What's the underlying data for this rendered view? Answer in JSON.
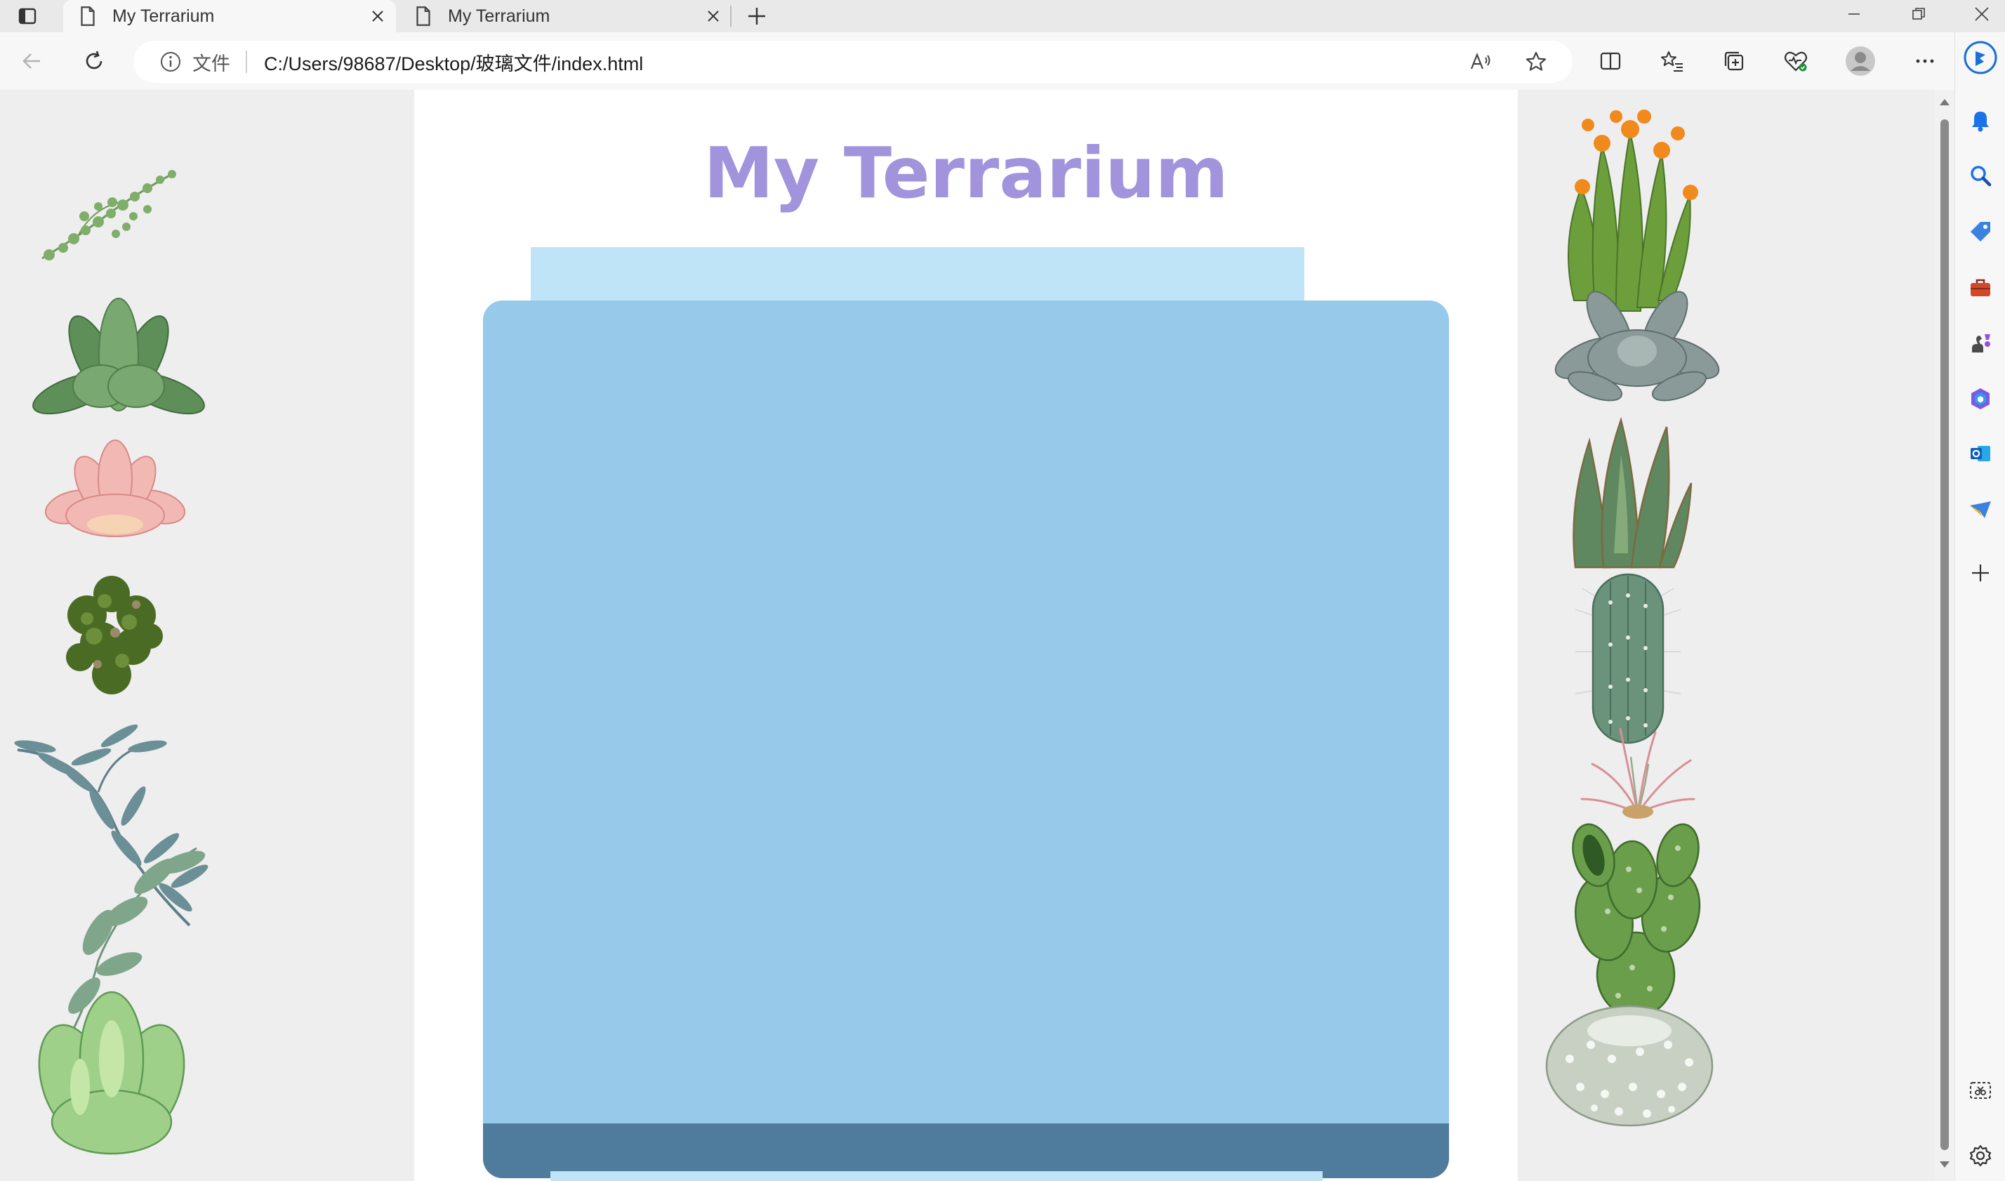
{
  "browser": {
    "tabs": [
      {
        "title": "My Terrarium",
        "active": true
      },
      {
        "title": "My Terrarium",
        "active": false
      }
    ],
    "address": {
      "scheme_label": "文件",
      "url": "C:/Users/98687/Desktop/玻璃文件/index.html"
    },
    "toolbar_icons": [
      "back-icon",
      "refresh-icon",
      "read-aloud-icon",
      "favorite-star-icon",
      "split-screen-icon",
      "favorites-icon",
      "collections-icon",
      "browser-essentials-icon",
      "profile-avatar",
      "more-options-icon"
    ],
    "sidebar_icons": [
      "bing-copilot-icon",
      "notifications-bell-icon",
      "search-icon",
      "shopping-tag-icon",
      "tools-icon",
      "games-icon",
      "office-icon",
      "outlook-icon",
      "send-icon",
      "add-icon",
      "screenshot-icon",
      "settings-icon"
    ]
  },
  "page": {
    "title": "My Terrarium",
    "colors": {
      "title": "#a193dc",
      "jar_top": "#bfe4f7",
      "jar_walls": "#97c9eb",
      "dirt": "#4f7c9d",
      "plant_container": "#eeeeee"
    },
    "left_plants": [
      "plant1",
      "plant2",
      "plant3",
      "plant4",
      "plant5",
      "plant6",
      "plant7"
    ],
    "right_plants": [
      "plant8",
      "plant9",
      "plant10",
      "plant11",
      "plant12",
      "plant13",
      "plant14"
    ]
  }
}
